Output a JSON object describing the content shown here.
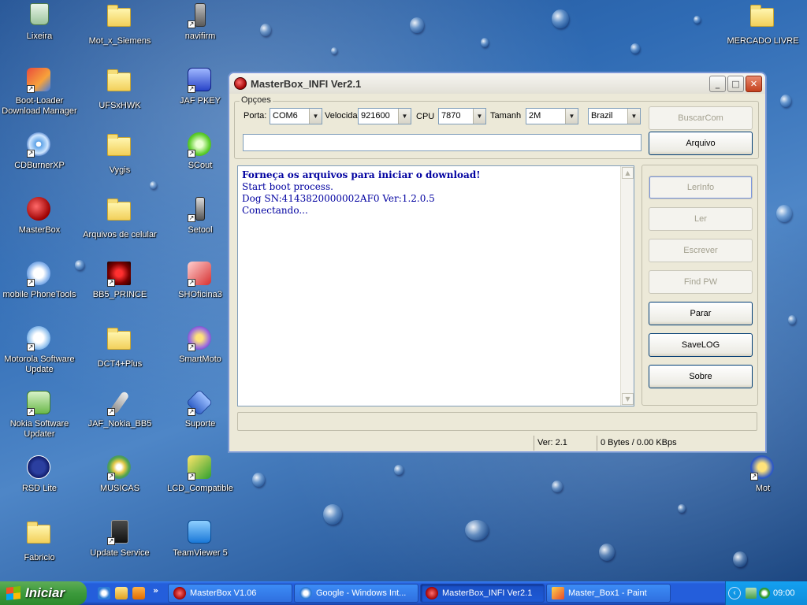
{
  "desktop": {
    "icons": [
      {
        "label": "Lixeira",
        "icon": "recycle-bin-icon"
      },
      {
        "label": "Mot_x_Siemens",
        "icon": "folder-icon"
      },
      {
        "label": "navifirm",
        "icon": "phone-app-icon"
      },
      {
        "label": "MERCADO LIVRE",
        "icon": "folder-icon"
      },
      {
        "label": "Boot-Loader Download Manager",
        "icon": "bootloader-app-icon"
      },
      {
        "label": "UFSxHWK",
        "icon": "folder-icon"
      },
      {
        "label": "JAF PKEY",
        "icon": "jaf-app-icon"
      },
      {
        "label": "CDBurnerXP",
        "icon": "cd-burner-icon"
      },
      {
        "label": "Vygis",
        "icon": "folder-icon"
      },
      {
        "label": "SCout",
        "icon": "scout-app-icon"
      },
      {
        "label": "MasterBox",
        "icon": "masterbox-app-icon"
      },
      {
        "label": "Arquivos de celular",
        "icon": "folder-icon"
      },
      {
        "label": "Setool",
        "icon": "setool-app-icon"
      },
      {
        "label": "mobile PhoneTools",
        "icon": "phonetools-app-icon"
      },
      {
        "label": "BB5_PRINCE",
        "icon": "bb5-app-icon"
      },
      {
        "label": "SHOficina3",
        "icon": "shoficina-app-icon"
      },
      {
        "label": "Motorola Software Update",
        "icon": "motorola-update-icon"
      },
      {
        "label": "DCT4+Plus",
        "icon": "folder-icon"
      },
      {
        "label": "SmartMoto",
        "icon": "smartmoto-app-icon"
      },
      {
        "label": "Nokia Software Updater",
        "icon": "nokia-updater-icon"
      },
      {
        "label": "JAF_Nokia_BB5",
        "icon": "jaf-nokia-icon"
      },
      {
        "label": "Suporte",
        "icon": "support-app-icon"
      },
      {
        "label": "RSD Lite",
        "icon": "motorola-rsd-icon"
      },
      {
        "label": "MUSICAS",
        "icon": "music-folder-icon"
      },
      {
        "label": "LCD_Compatible",
        "icon": "lcd-app-icon"
      },
      {
        "label": "Mot",
        "icon": "mot-app-icon"
      },
      {
        "label": "Fabricio",
        "icon": "folder-icon"
      },
      {
        "label": "Update Service",
        "icon": "update-service-icon"
      },
      {
        "label": "TeamViewer 5",
        "icon": "teamviewer-icon"
      }
    ]
  },
  "window": {
    "title": "MasterBox_INFI Ver2.1",
    "options_group": "Opçoes",
    "porta_label": "Porta:",
    "porta_value": "COM6",
    "velocidade_label": "Velocida",
    "velocidade_value": "921600",
    "cpu_label": "CPU",
    "cpu_value": "7870",
    "tamanho_label": "Tamanh",
    "tamanho_value": "2M",
    "region_value": "Brazil",
    "path_value": "",
    "buttons": {
      "buscarcom": "BuscarCom",
      "arquivo": "Arquivo",
      "lerinfo": "LerInfo",
      "ler": "Ler",
      "escrever": "Escrever",
      "findpw": "Find PW",
      "parar": "Parar",
      "savelog": "SaveLOG",
      "sobre": "Sobre"
    },
    "log_lines": [
      "Forneça os arquivos para iniciar o download!",
      "Start boot process.",
      "Dog SN:4143820000002AF0 Ver:1.2.0.5",
      "Conectando..."
    ],
    "status_version": "Ver: 2.1",
    "status_transfer": "0 Bytes / 0.00 KBps"
  },
  "taskbar": {
    "start_label": "Iniciar",
    "tasks": [
      {
        "label": "MasterBox V1.06"
      },
      {
        "label": "Google - Windows Int..."
      },
      {
        "label": "MasterBox_INFI Ver2.1"
      },
      {
        "label": "Master_Box1 - Paint"
      }
    ],
    "clock": "09:00"
  },
  "colors": {
    "log_text": "#0000a0",
    "taskbar": "#245edb",
    "start_button": "#3c9a3c"
  }
}
